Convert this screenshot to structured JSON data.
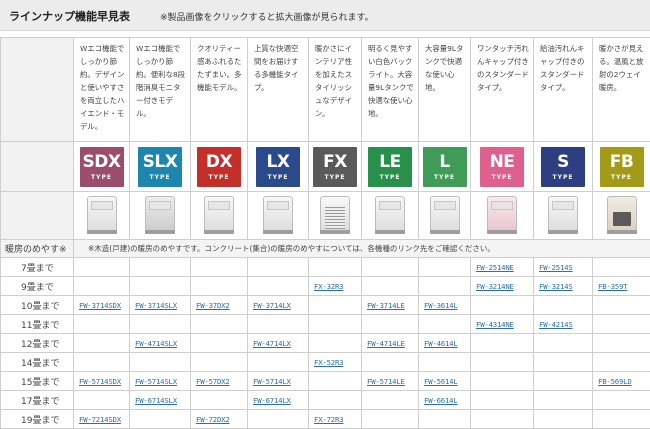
{
  "header": {
    "title": "ラインナップ機能早見表",
    "note": "※製品画像をクリックすると拡大画像が見られます。"
  },
  "models": [
    {
      "desc": "Wエコ機能でしっかり節約。デザインと使いやすさを両立したハイエンド・モデル。",
      "code": "SDX",
      "sub": "TYPE",
      "color": "#9c4d6e",
      "image": "heater-white-icon"
    },
    {
      "desc": "Wエコ機能でしっかり節約。便利な8段階消臭モニター付きモデル。",
      "code": "SLX",
      "sub": "TYPE",
      "color": "#1d86ae",
      "image": "heater-silver-icon"
    },
    {
      "desc": "クオリティー感あふれるたたずまい。多機能モデル。",
      "code": "DX",
      "sub": "TYPE",
      "color": "#c42f2a",
      "image": "heater-white-icon"
    },
    {
      "desc": "上質な快適空間をお届けする多機能タイプ。",
      "code": "LX",
      "sub": "TYPE",
      "color": "#2a4a8c",
      "image": "heater-white-icon"
    },
    {
      "desc": "暖かさにインテリア性を加えたスタイリッシュなデザイン。",
      "code": "FX",
      "sub": "TYPE",
      "color": "#5a5a5a",
      "image": "heater-grill-icon"
    },
    {
      "desc": "明るく見やすい白色バックライト。大容量9Lタンクで快適な使い心地。",
      "code": "LE",
      "sub": "TYPE",
      "color": "#27904a",
      "image": "heater-white-icon"
    },
    {
      "desc": "大容量9Lタンクで快適な使い心地。",
      "code": "L",
      "sub": "TYPE",
      "color": "#3f9b55",
      "image": "heater-white-icon"
    },
    {
      "desc": "ワンタッチ汚れんキャップ付きのスタンダードタイプ。",
      "code": "NE",
      "sub": "TYPE",
      "color": "#df5f8e",
      "image": "heater-pink-icon"
    },
    {
      "desc": "給油汚れんキャップ付きのスタンダードタイプ。",
      "code": "S",
      "sub": "TYPE",
      "color": "#2d3f80",
      "image": "heater-white-icon"
    },
    {
      "desc": "暖かさが見える。温風と放射の2ウェイ暖房。",
      "code": "FB",
      "sub": "TYPE",
      "color": "#a39a16",
      "image": "heater-window-icon"
    }
  ],
  "note_row": {
    "label": "暖房のめやす※",
    "text": "※木造(戸建)の暖房のめやすです。コンクリート(集合)の暖房のめやすについては、各機種のリンク先をご確認ください。"
  },
  "rows": [
    {
      "label": "7畳まで",
      "cells": [
        "",
        "",
        "",
        "",
        "",
        "",
        "",
        "FW-2514NE",
        "FW-2514S",
        ""
      ]
    },
    {
      "label": "9畳まで",
      "cells": [
        "",
        "",
        "",
        "",
        "FX-32R3",
        "",
        "",
        "FW-3214NE",
        "FW-3214S",
        "FB-359T"
      ]
    },
    {
      "label": "10畳まで",
      "cells": [
        "FW-3714SDX",
        "FW-3714SLX",
        "FW-37DX2",
        "FW-3714LX",
        "",
        "FW-3714LE",
        "FW-3614L",
        "",
        "",
        ""
      ]
    },
    {
      "label": "11畳まで",
      "cells": [
        "",
        "",
        "",
        "",
        "",
        "",
        "",
        "FW-4314NE",
        "FW-4214S",
        ""
      ]
    },
    {
      "label": "12畳まで",
      "cells": [
        "",
        "FW-4714SLX",
        "",
        "FW-4714LX",
        "",
        "FW-4714LE",
        "FW-4614L",
        "",
        "",
        ""
      ]
    },
    {
      "label": "14畳まで",
      "cells": [
        "",
        "",
        "",
        "",
        "FX-52R3",
        "",
        "",
        "",
        "",
        ""
      ]
    },
    {
      "label": "15畳まで",
      "cells": [
        "FW-5714SDX",
        "FW-5714SLX",
        "FW-57DX2",
        "FW-5714LX",
        "",
        "FW-5714LE",
        "FW-5614L",
        "",
        "",
        "FB-569LD"
      ]
    },
    {
      "label": "17畳まで",
      "cells": [
        "",
        "FW-6714SLX",
        "",
        "FW-6714LX",
        "",
        "",
        "FW-6614L",
        "",
        "",
        ""
      ]
    },
    {
      "label": "19畳まで",
      "cells": [
        "FW-7214SDX",
        "",
        "FW-72DX2",
        "",
        "FX-72R3",
        "",
        "",
        "",
        "",
        ""
      ]
    }
  ]
}
